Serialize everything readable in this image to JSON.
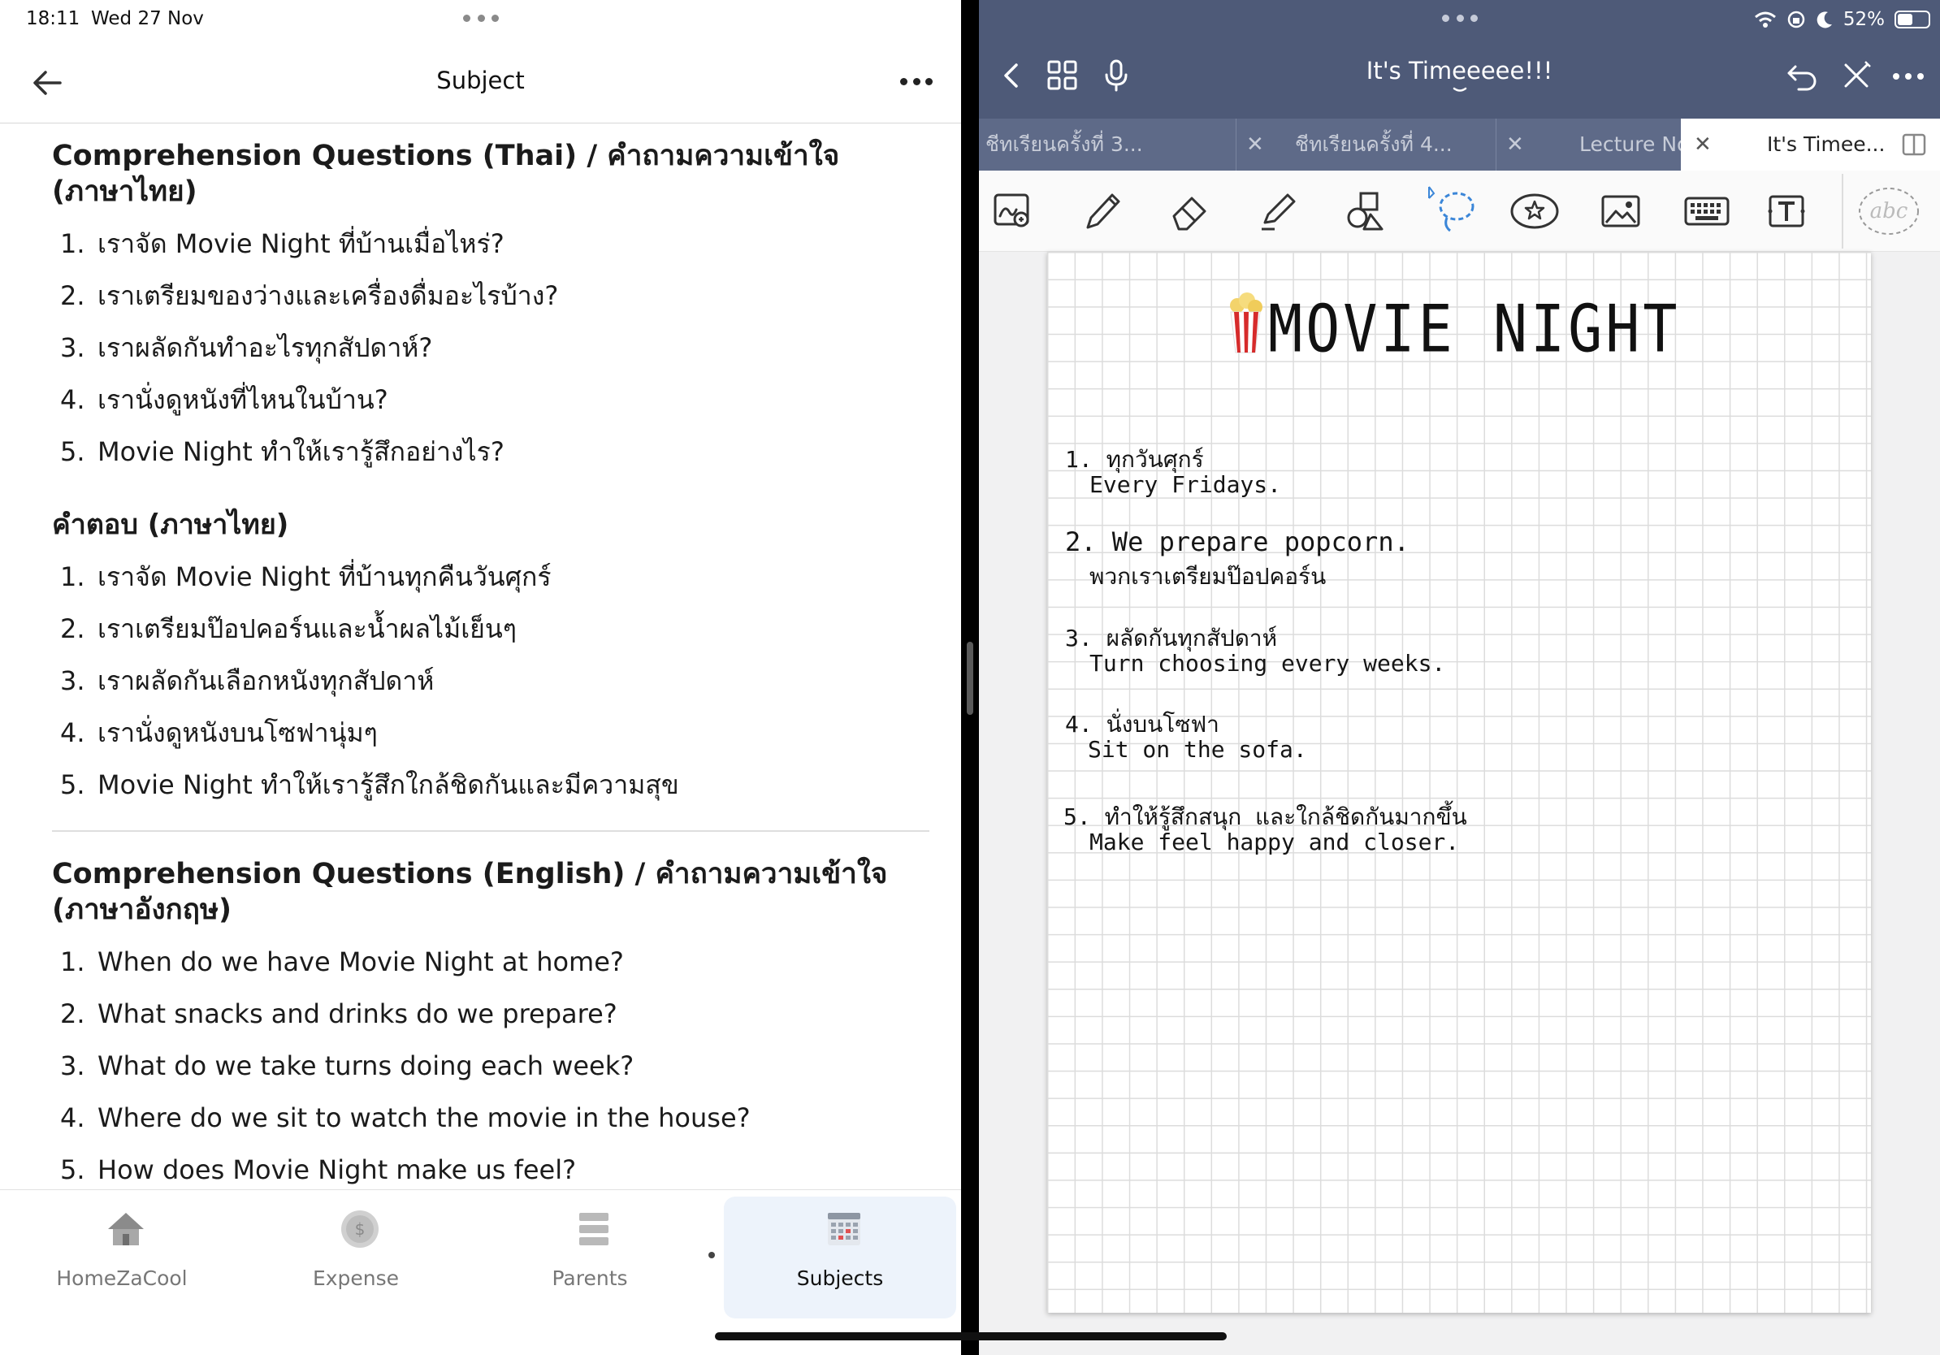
{
  "status": {
    "time": "18:11",
    "date": "Wed 27 Nov",
    "battery": "52%"
  },
  "left_app": {
    "header_title": "Subject",
    "sections": {
      "q_thai_title": "Comprehension Questions (Thai) / คำถามความเข้าใจ (ภาษาไทย)",
      "q_thai": [
        "เราจัด Movie Night ที่บ้านเมื่อไหร่?",
        "เราเตรียมของว่างและเครื่องดื่มอะไรบ้าง?",
        "เราผลัดกันทำอะไรทุกสัปดาห์?",
        "เรานั่งดูหนังที่ไหนในบ้าน?",
        "Movie Night ทำให้เรารู้สึกอย่างไร?"
      ],
      "a_thai_title": "คำตอบ (ภาษาไทย)",
      "a_thai": [
        "เราจัด Movie Night ที่บ้านทุกคืนวันศุกร์",
        "เราเตรียมป๊อปคอร์นและน้ำผลไม้เย็นๆ",
        "เราผลัดกันเลือกหนังทุกสัปดาห์",
        "เรานั่งดูหนังบนโซฟานุ่มๆ",
        "Movie Night ทำให้เรารู้สึกใกล้ชิดกันและมีความสุข"
      ],
      "q_eng_title": "Comprehension Questions (English) / คำถามความเข้าใจ (ภาษาอังกฤษ)",
      "q_eng": [
        "When do we have Movie Night at home?",
        "What snacks and drinks do we prepare?",
        "What do we take turns doing each week?",
        "Where do we sit to watch the movie in the house?",
        "How does Movie Night make us feel?"
      ]
    },
    "tabs": [
      {
        "label": "HomeZaCool",
        "icon": "home-icon"
      },
      {
        "label": "Expense",
        "icon": "coin-icon"
      },
      {
        "label": "Parents",
        "icon": "list-icon"
      },
      {
        "label": "Subjects",
        "icon": "calendar-icon",
        "active": true
      }
    ]
  },
  "right_app": {
    "doc_title": "It's Timeeeee!!!",
    "doc_tabs": [
      {
        "label": "ชีทเรียนครั้งที่ 3..."
      },
      {
        "label": "ชีทเรียนครั้งที่ 4..."
      },
      {
        "label": "Lecture Note..."
      },
      {
        "label": "It's Timee...",
        "active": true
      }
    ],
    "tools": [
      "zoom-window-icon",
      "pen-icon",
      "eraser-icon",
      "highlighter-icon",
      "shapes-icon",
      "lasso-icon",
      "sticker-icon",
      "image-icon",
      "keyboard-icon",
      "text-icon",
      "handwriting-text-icon"
    ],
    "page": {
      "title": "MOVIE NIGHT",
      "lines": [
        "1. ทุกวันศุกร์",
        "Every Fridays.",
        "2. We prepare popcorn.",
        "พวกเราเตรียมป๊อปคอร์น",
        "3. ผลัดกันทุกสัปดาห์",
        "Turn choosing every weeks.",
        "4. นั่งบนโซฟา",
        "Sit on the sofa.",
        "5. ทำให้รู้สึกสนุก และใกล้ชิดกันมากขึ้น",
        "Make feel happy and closer."
      ]
    },
    "colors": {
      "header": "#4e5a78",
      "tabs": "#5e6a88",
      "lasso": "#3b86d8",
      "popcorn_red": "#d62b2b"
    }
  }
}
